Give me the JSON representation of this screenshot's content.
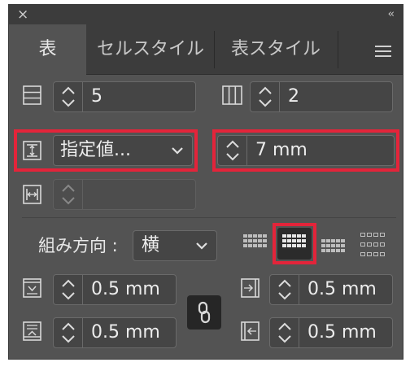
{
  "window": {
    "close_icon": "×",
    "collapse_icon": "‹‹"
  },
  "tabs": [
    {
      "label": "表",
      "active": true
    },
    {
      "label": "セルスタイル",
      "active": false
    },
    {
      "label": "表スタイル",
      "active": false
    }
  ],
  "table": {
    "rows_value": "5",
    "columns_value": "2",
    "row_height_mode": "指定値...",
    "row_height_value": "7 mm",
    "column_width_value": ""
  },
  "text_direction": {
    "label": "組み方向 :",
    "value": "横"
  },
  "insets": {
    "top": "0.5 mm",
    "bottom": "0.5 mm",
    "left": "0.5 mm",
    "right": "0.5 mm"
  },
  "colors": {
    "highlight": "#e3243a",
    "panel": "#535353",
    "tabbar": "#3c3c3c"
  }
}
